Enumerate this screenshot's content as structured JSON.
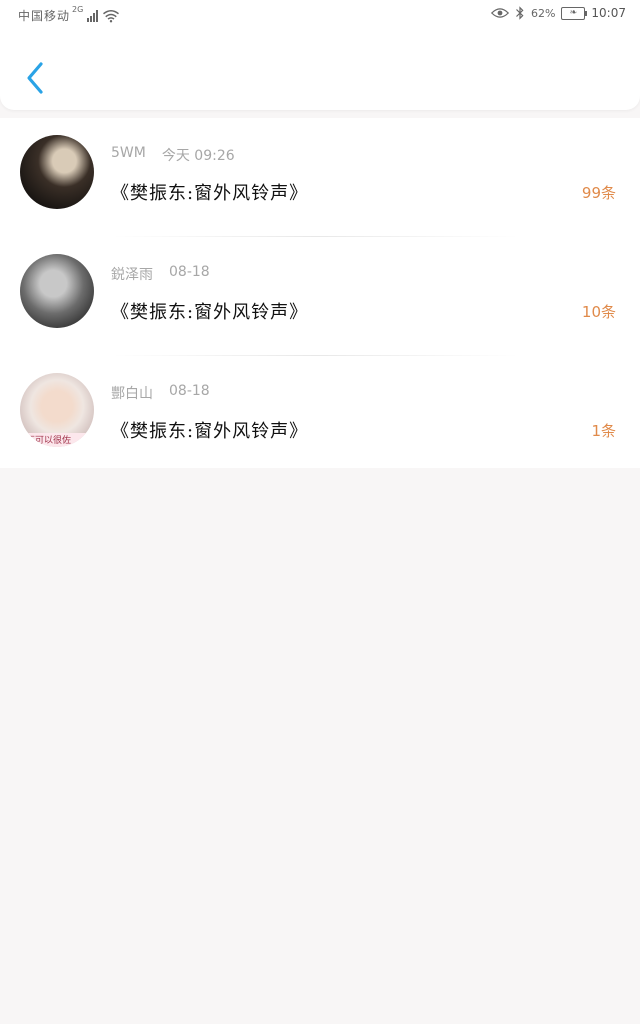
{
  "status_bar": {
    "carrier": "中国移动",
    "network_type": "2G",
    "battery_percent": "62%",
    "time": "10:07",
    "icons": [
      "signal-icon",
      "wifi-icon",
      "eye-icon",
      "bluetooth-icon",
      "battery-icon"
    ]
  },
  "header": {
    "back_icon": "chevron-left-icon"
  },
  "list": {
    "items": [
      {
        "user": "5WM",
        "time": "今天 09:26",
        "title": "《樊振东:窗外风铃声》",
        "count": "99条"
      },
      {
        "user": "鋭泽雨",
        "time": "08-18",
        "title": "《樊振东:窗外风铃声》",
        "count": "10条"
      },
      {
        "user": "酆白山",
        "time": "08-18",
        "title": "《樊振东:窗外风铃声》",
        "count": "1条"
      }
    ],
    "avatar_caption_3": "不可以很佐"
  },
  "colors": {
    "accent": "#2aa3e6",
    "count": "#e08a4a",
    "meta_text": "#a7a7a7",
    "background": "#f8f6f6"
  }
}
